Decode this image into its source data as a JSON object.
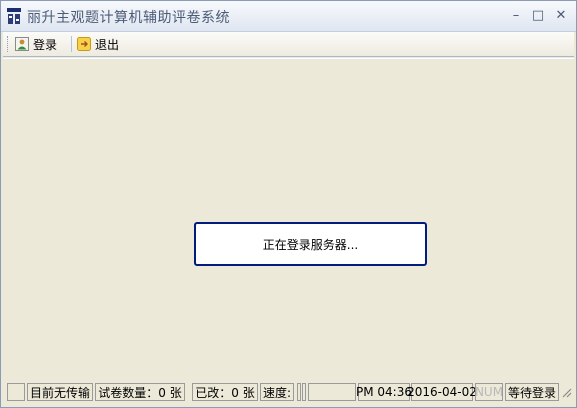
{
  "window": {
    "title": "丽升主观题计算机辅助评卷系统"
  },
  "controls": {
    "minimize": "–",
    "maximize": "□",
    "close": "✕"
  },
  "toolbar": {
    "login_label": "登录",
    "exit_label": "退出"
  },
  "dialog": {
    "message": "正在登录服务器..."
  },
  "status": {
    "transfer": "目前无传输",
    "papers": "试卷数量：0 张",
    "modified": "已改：0 张",
    "speed": "速度:",
    "time": "PM 04:36",
    "date": "2016-04-02",
    "num": "NUM",
    "state": "等待登录"
  },
  "icons": {
    "app": "app-logo-icon",
    "login": "login-icon",
    "exit": "exit-icon"
  }
}
